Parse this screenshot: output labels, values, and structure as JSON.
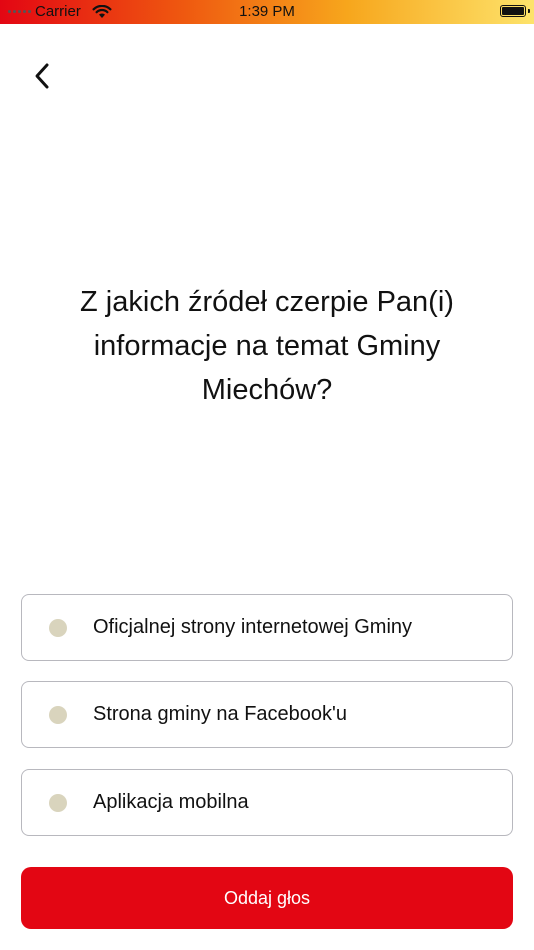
{
  "status_bar": {
    "carrier": "Carrier",
    "time": "1:39 PM",
    "icons": [
      "signal-dots-icon",
      "wifi-icon",
      "battery-icon"
    ]
  },
  "nav": {
    "back_icon": "chevron-left-icon"
  },
  "question": {
    "line1": "Z jakich źródeł czerpie Pan(i)",
    "line2": "informacje na temat Gminy",
    "line3": "Miechów?"
  },
  "options": [
    {
      "label": "Oficjalnej strony internetowej Gminy",
      "selected": false
    },
    {
      "label": "Strona gminy na Facebook'u",
      "selected": false
    },
    {
      "label": "Aplikacja mobilna",
      "selected": false
    }
  ],
  "submit": {
    "label": "Oddaj głos"
  },
  "colors": {
    "accent": "#e30613",
    "radio_unselected": "#d9d4bd",
    "option_border": "#b8b8be"
  }
}
